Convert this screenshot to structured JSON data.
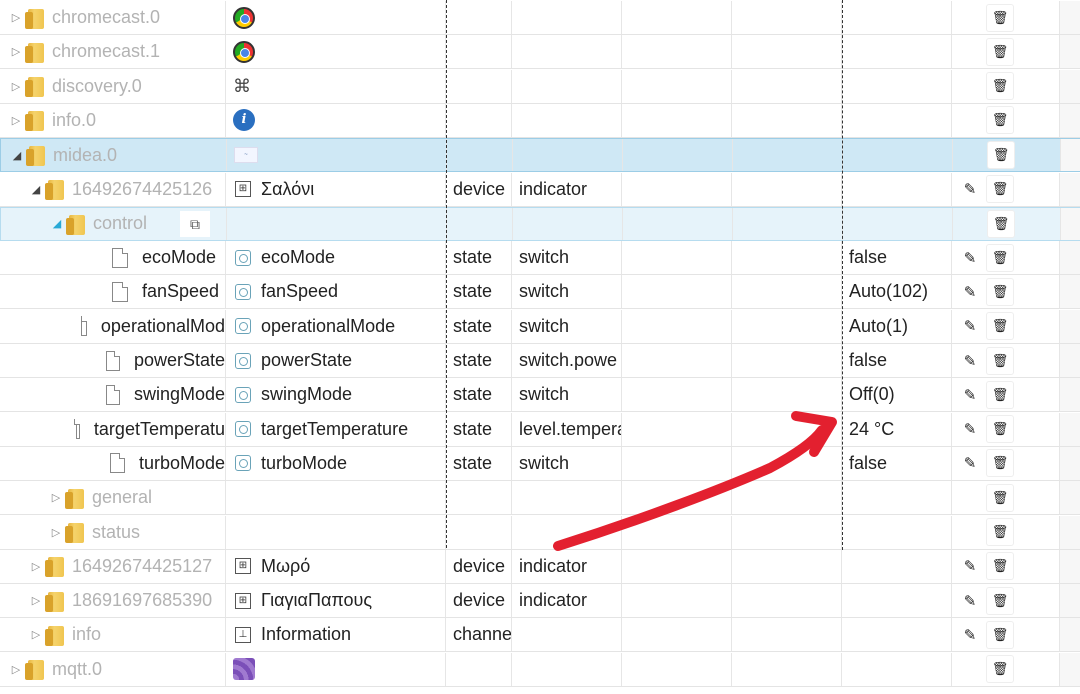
{
  "arrow_color": "#e3202f",
  "rows": [
    {
      "id": "chromecast-0",
      "name": "chromecast.0",
      "indent": 0,
      "toggle": "closed",
      "kind": "folder",
      "grey": true,
      "icon": "chrome-icon",
      "label": "",
      "role": "",
      "func": "",
      "value": "",
      "edit": false,
      "del": true
    },
    {
      "id": "chromecast-1",
      "name": "chromecast.1",
      "indent": 0,
      "toggle": "closed",
      "kind": "folder",
      "grey": true,
      "icon": "chrome-icon",
      "label": "",
      "role": "",
      "func": "",
      "value": "",
      "edit": false,
      "del": true
    },
    {
      "id": "discovery-0",
      "name": "discovery.0",
      "indent": 0,
      "toggle": "closed",
      "kind": "folder",
      "grey": true,
      "icon": "binoculars-icon",
      "label": "",
      "role": "",
      "func": "",
      "value": "",
      "edit": false,
      "del": true
    },
    {
      "id": "info-0",
      "name": "info.0",
      "indent": 0,
      "toggle": "closed",
      "kind": "folder",
      "grey": true,
      "icon": "info-icon",
      "label": "",
      "role": "",
      "func": "",
      "value": "",
      "edit": false,
      "del": true
    },
    {
      "id": "midea-0",
      "name": "midea.0",
      "indent": 0,
      "toggle": "open",
      "kind": "folder",
      "grey": true,
      "icon": "midea-logo-icon",
      "label": "",
      "role": "",
      "func": "",
      "value": "",
      "edit": false,
      "del": true,
      "selected": "strong"
    },
    {
      "id": "device-16492674425126",
      "name": "16492674425126",
      "indent": 1,
      "toggle": "open",
      "kind": "folder",
      "grey": true,
      "icon": "device-icon",
      "label": "Σαλόνι",
      "role": "device",
      "func": "indicator",
      "value": "",
      "edit": true,
      "del": true
    },
    {
      "id": "control",
      "name": "control",
      "indent": 2,
      "toggle": "open-blue",
      "kind": "folder",
      "grey": true,
      "icon": "",
      "label": "",
      "role": "",
      "func": "",
      "value": "",
      "edit": false,
      "del": true,
      "selected": "light",
      "copy": true
    },
    {
      "id": "ecoMode",
      "name": "ecoMode",
      "indent": 3,
      "toggle": "none",
      "kind": "file",
      "grey": false,
      "icon": "state-icon",
      "label": "ecoMode",
      "role": "state",
      "func": "switch",
      "value": "false",
      "edit": true,
      "del": true
    },
    {
      "id": "fanSpeed",
      "name": "fanSpeed",
      "indent": 3,
      "toggle": "none",
      "kind": "file",
      "grey": false,
      "icon": "state-icon",
      "label": "fanSpeed",
      "role": "state",
      "func": "switch",
      "value": "Auto(102)",
      "edit": true,
      "del": true
    },
    {
      "id": "operationalMode",
      "name": "operationalMod",
      "indent": 3,
      "toggle": "none",
      "kind": "file",
      "grey": false,
      "icon": "state-icon",
      "label": "operationalMode",
      "role": "state",
      "func": "switch",
      "value": "Auto(1)",
      "edit": true,
      "del": true
    },
    {
      "id": "powerState",
      "name": "powerState",
      "indent": 3,
      "toggle": "none",
      "kind": "file",
      "grey": false,
      "icon": "state-icon",
      "label": "powerState",
      "role": "state",
      "func": "switch.powe",
      "value": "false",
      "edit": true,
      "del": true
    },
    {
      "id": "swingMode",
      "name": "swingMode",
      "indent": 3,
      "toggle": "none",
      "kind": "file",
      "grey": false,
      "icon": "state-icon",
      "label": "swingMode",
      "role": "state",
      "func": "switch",
      "value": "Off(0)",
      "edit": true,
      "del": true
    },
    {
      "id": "targetTemperature",
      "name": "targetTemperatu",
      "indent": 3,
      "toggle": "none",
      "kind": "file",
      "grey": false,
      "icon": "state-icon",
      "label": "targetTemperature",
      "role": "state",
      "func": "level.tempera",
      "value": "24 °C",
      "edit": true,
      "del": true
    },
    {
      "id": "turboMode",
      "name": "turboMode",
      "indent": 3,
      "toggle": "none",
      "kind": "file",
      "grey": false,
      "icon": "state-icon",
      "label": "turboMode",
      "role": "state",
      "func": "switch",
      "value": "false",
      "edit": true,
      "del": true
    },
    {
      "id": "general",
      "name": "general",
      "indent": 2,
      "toggle": "closed",
      "kind": "folder",
      "grey": true,
      "icon": "",
      "label": "",
      "role": "",
      "func": "",
      "value": "",
      "edit": false,
      "del": true
    },
    {
      "id": "status",
      "name": "status",
      "indent": 2,
      "toggle": "closed",
      "kind": "folder",
      "grey": true,
      "icon": "",
      "label": "",
      "role": "",
      "func": "",
      "value": "",
      "edit": false,
      "del": true
    },
    {
      "id": "device-16492674425127",
      "name": "16492674425127",
      "indent": 1,
      "toggle": "closed",
      "kind": "folder",
      "grey": true,
      "icon": "device-icon",
      "label": "Μωρό",
      "role": "device",
      "func": "indicator",
      "value": "",
      "edit": true,
      "del": true
    },
    {
      "id": "device-18691697685390",
      "name": "18691697685390",
      "indent": 1,
      "toggle": "closed",
      "kind": "folder",
      "grey": true,
      "icon": "device-icon",
      "label": "ΓιαγιαΠαπους",
      "role": "device",
      "func": "indicator",
      "value": "",
      "edit": true,
      "del": true
    },
    {
      "id": "info",
      "name": "info",
      "indent": 1,
      "toggle": "closed",
      "kind": "folder",
      "grey": true,
      "icon": "channel-icon",
      "label": "Information",
      "role": "channe",
      "func": "",
      "value": "",
      "edit": true,
      "del": true
    },
    {
      "id": "mqtt-0",
      "name": "mqtt.0",
      "indent": 0,
      "toggle": "closed",
      "kind": "folder",
      "grey": true,
      "icon": "mqtt-icon",
      "label": "",
      "role": "",
      "func": "",
      "value": "",
      "edit": false,
      "del": true
    }
  ]
}
